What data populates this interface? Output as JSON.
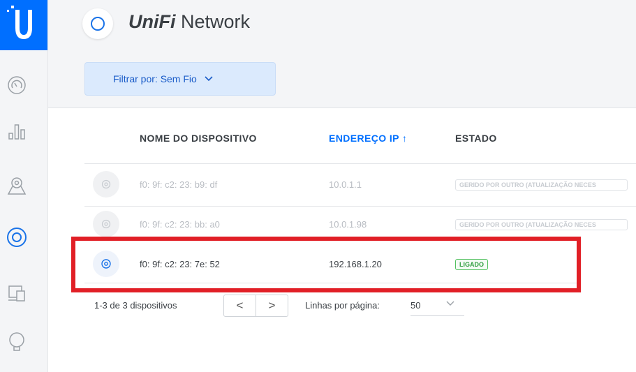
{
  "app": {
    "title_brand": "UniFi",
    "title_rest": "Network"
  },
  "filter": {
    "label": "Filtrar por:",
    "value": "Sem Fio"
  },
  "table": {
    "headers": {
      "name": "NOME DO DISPOSITIVO",
      "ip": "ENDEREÇO IP",
      "ip_sort": "↑",
      "status": "ESTADO"
    },
    "rows": [
      {
        "name": "f0: 9f: c2: 23: b9: df",
        "ip": "10.0.1.1",
        "status": "GERIDO POR OUTRO (ATUALIZAÇÃO NECES"
      },
      {
        "name": "f0: 9f: c2: 23: bb: a0",
        "ip": "10.0.1.98",
        "status": "GERIDO POR OUTRO (ATUALIZAÇÃO NECES"
      },
      {
        "name": "f0: 9f: c2: 23: 7e: 52",
        "ip": "192.168.1.20",
        "status": "LIGADO"
      }
    ]
  },
  "pagination": {
    "summary": "1-3 de 3 dispositivos",
    "prev": "<",
    "next": ">",
    "rows_label": "Linhas por página:",
    "rows_value": "50"
  },
  "icons": [
    "unifi-logo-icon",
    "dashboard-icon",
    "statistics-icon",
    "map-icon",
    "devices-icon",
    "clients-icon",
    "insights-icon"
  ],
  "colors": {
    "accent": "#006fff",
    "highlight": "#e11f26",
    "status_ok": "#2e9c3e"
  }
}
